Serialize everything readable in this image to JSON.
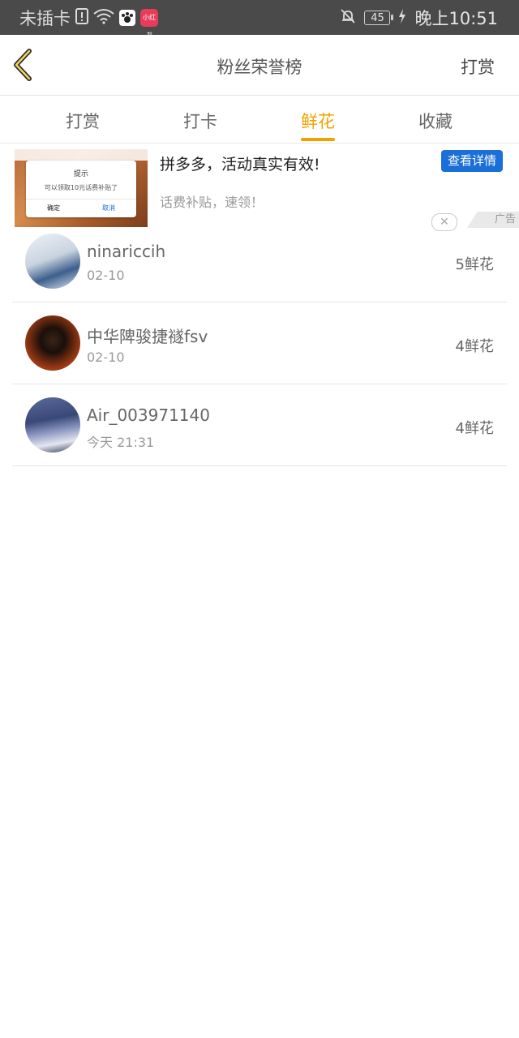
{
  "status_bar": {
    "carrier": "未插卡",
    "battery": "45",
    "time": "晚上10:51",
    "app2_label": "小红书"
  },
  "nav": {
    "title": "粉丝荣誉榜",
    "right_action": "打赏"
  },
  "tabs": [
    {
      "label": "打赏",
      "active": false
    },
    {
      "label": "打卡",
      "active": false
    },
    {
      "label": "鲜花",
      "active": true
    },
    {
      "label": "收藏",
      "active": false
    }
  ],
  "ad": {
    "title": "拼多多，活动真实有效!",
    "subtitle": "话费补贴，速领！",
    "cta": "查看详情",
    "label": "广告",
    "dialog": {
      "title": "提示",
      "body": "可以领取10元话费补贴了",
      "ok": "确定",
      "cancel": "取消"
    }
  },
  "list": [
    {
      "name": "ninariccih",
      "date": "02-10",
      "count": "5鲜花"
    },
    {
      "name": "中华陴骏捷禭fsv",
      "date": "02-10",
      "count": "4鲜花"
    },
    {
      "name": "Air_003971140",
      "date": "今天 21:31",
      "count": "4鲜花"
    }
  ],
  "colors": {
    "accent": "#f0a300",
    "cta_blue": "#1a6fd8",
    "status_bar": "#4a4a4a"
  }
}
